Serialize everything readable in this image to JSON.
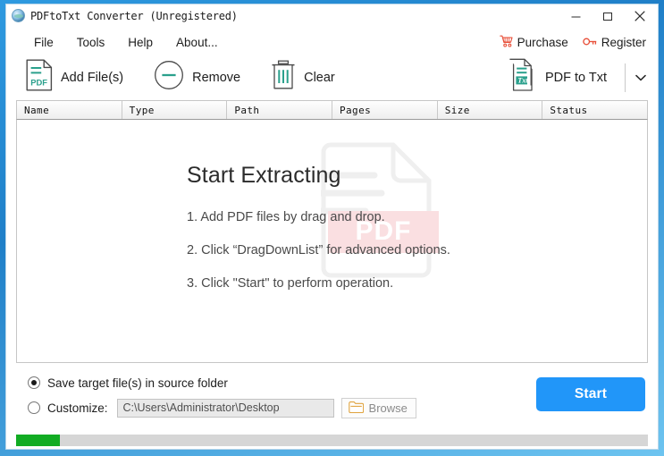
{
  "window": {
    "title": "PDFtoTxt Converter  (Unregistered)",
    "app_icon": "globe-icon",
    "controls": {
      "minimize": "minimize-icon",
      "maximize": "maximize-icon",
      "close": "close-icon"
    }
  },
  "menubar": {
    "items": [
      {
        "label": "File"
      },
      {
        "label": "Tools"
      },
      {
        "label": "Help"
      },
      {
        "label": "About..."
      }
    ],
    "links": [
      {
        "label": "Purchase",
        "icon": "shopping-cart-icon",
        "color": "#e8503a"
      },
      {
        "label": "Register",
        "icon": "key-icon",
        "color": "#e8503a"
      }
    ]
  },
  "toolbar": {
    "add_files_label": "Add File(s)",
    "add_files_icon": "pdf-document-icon",
    "remove_label": "Remove",
    "remove_icon": "circle-minus-icon",
    "clear_label": "Clear",
    "clear_icon": "trash-icon",
    "convert_label": "PDF to Txt",
    "convert_icon": "txt-document-icon",
    "dropdown_icon": "chevron-down-icon",
    "accent_color": "#2aa08c"
  },
  "file_list": {
    "columns": [
      "Name",
      "Type",
      "Path",
      "Pages",
      "Size",
      "Status"
    ],
    "rows": []
  },
  "dropzone": {
    "heading": "Start Extracting",
    "steps": [
      "1. Add PDF files by drag and drop.",
      "2. Click “DragDownList” for advanced options.",
      "3. Click \"Start\" to perform operation."
    ],
    "watermark": {
      "label": "PDF",
      "band_color": "#fadfe1",
      "outline_color": "#efefef"
    }
  },
  "options": {
    "save_source_label": "Save target file(s) in source folder",
    "save_source_selected": true,
    "customize_label": "Customize:",
    "customize_selected": false,
    "path_value": "C:\\Users\\Administrator\\Desktop",
    "browse_label": "Browse",
    "browse_icon": "folder-icon",
    "start_label": "Start",
    "start_color": "#2196f9"
  },
  "progress": {
    "percent": 7,
    "fill_color": "#12ac23",
    "track_color": "#d6d6d6"
  }
}
